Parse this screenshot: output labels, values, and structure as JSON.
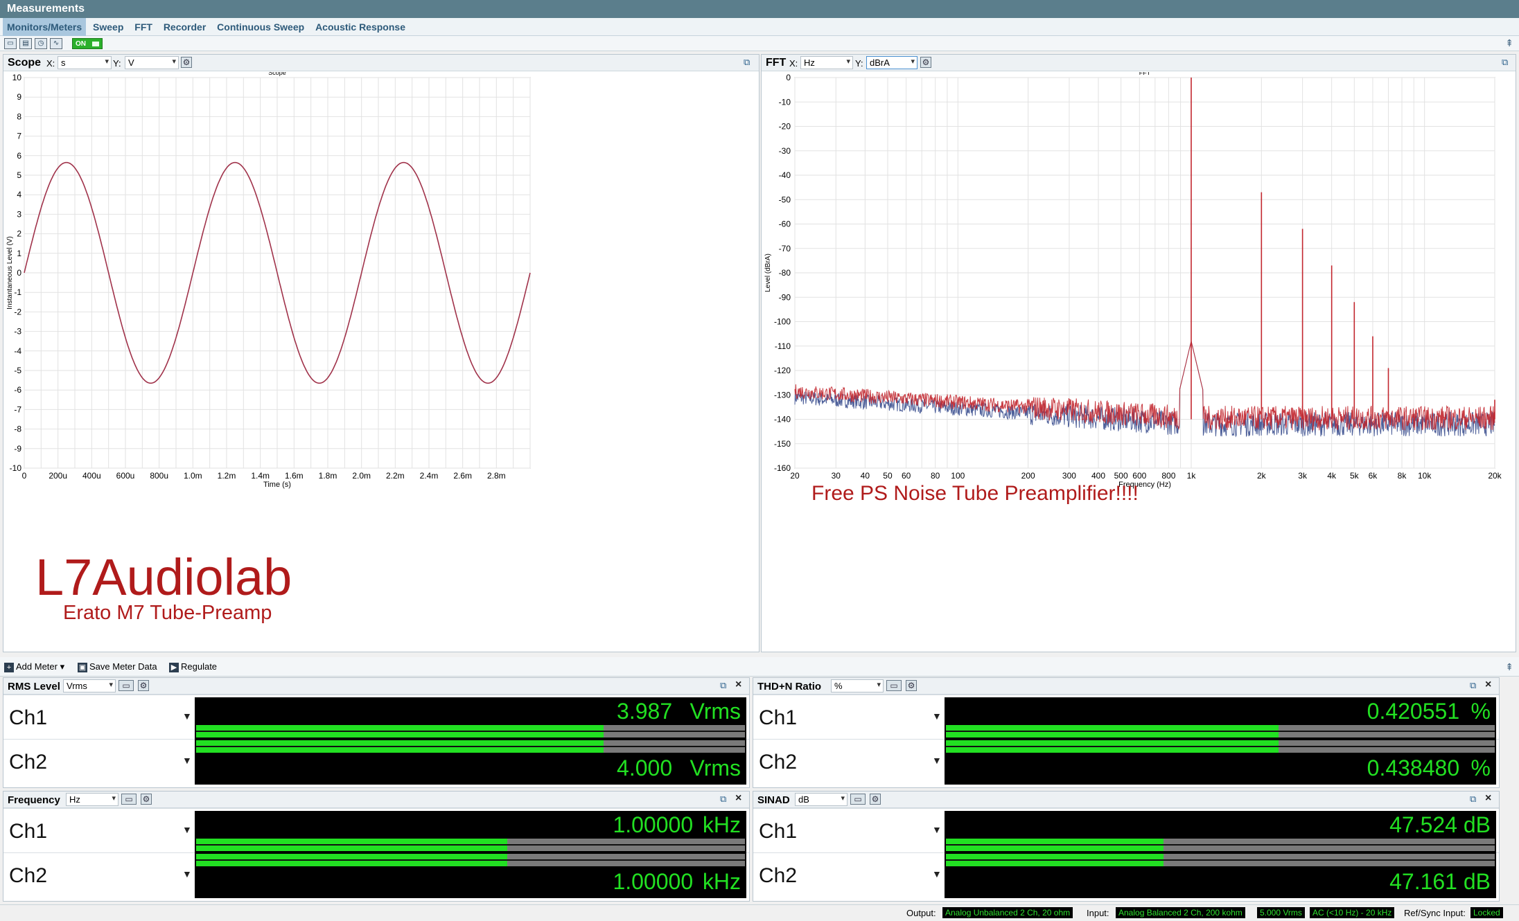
{
  "window": {
    "title": "Measurements"
  },
  "tabs": [
    "Monitors/Meters",
    "Sweep",
    "FFT",
    "Recorder",
    "Continuous Sweep",
    "Acoustic Response"
  ],
  "toolbar": {
    "on_label": "ON"
  },
  "scope": {
    "title": "Scope",
    "x_label": "X:",
    "x_unit": "s",
    "y_label": "Y:",
    "y_unit": "V"
  },
  "fft": {
    "title": "FFT",
    "x_label": "X:",
    "x_unit": "Hz",
    "y_label": "Y:",
    "y_unit": "dBrA"
  },
  "watermark": {
    "brand": "L7Audiolab",
    "subtitle": "Erato M7 Tube-Preamp",
    "fft_note": "Free PS Noise Tube Preamplifier!!!!"
  },
  "chart_data": [
    {
      "type": "line",
      "title": "Scope",
      "xlabel": "Time (s)",
      "ylabel": "Instantaneous Level (V)",
      "xlim": [
        0,
        0.003
      ],
      "ylim": [
        -10,
        10
      ],
      "grid": true,
      "x_ticks": [
        "0",
        "200u",
        "400u",
        "600u",
        "800u",
        "1.0m",
        "1.2m",
        "1.4m",
        "1.6m",
        "1.8m",
        "2.0m",
        "2.2m",
        "2.4m",
        "2.6m",
        "2.8m"
      ],
      "y_ticks": [
        "10",
        "9",
        "8",
        "7",
        "6",
        "5",
        "4",
        "3",
        "2",
        "1",
        "0",
        "-1",
        "-2",
        "-3",
        "-4",
        "-5",
        "-6",
        "-7",
        "-8",
        "-9",
        "-10"
      ],
      "series": [
        {
          "color": "#a0324a",
          "waveform": "sine",
          "frequency_hz": 1000,
          "amplitude_v": 5.65,
          "phase_deg": 0
        }
      ]
    },
    {
      "type": "line",
      "title": "FFT",
      "xlabel": "Frequency (Hz)",
      "ylabel": "Level (dBrA)",
      "xscale": "log",
      "xlim": [
        20,
        20000
      ],
      "ylim": [
        -160,
        0
      ],
      "grid": true,
      "x_ticks": [
        "20",
        "30",
        "40",
        "50",
        "60",
        "80",
        "100",
        "200",
        "300",
        "400",
        "500",
        "600",
        "800",
        "1k",
        "2k",
        "3k",
        "4k",
        "5k",
        "6k",
        "8k",
        "10k",
        "20k"
      ],
      "y_ticks": [
        "0",
        "-10",
        "-20",
        "-30",
        "-40",
        "-50",
        "-60",
        "-70",
        "-80",
        "-90",
        "-100",
        "-110",
        "-120",
        "-130",
        "-140",
        "-150",
        "-160"
      ],
      "noise_floor_db": -141,
      "series": [
        {
          "name": "Ch1",
          "color": "#3b4f8f"
        },
        {
          "name": "Ch2",
          "color": "#c2262e"
        }
      ],
      "peaks": [
        {
          "freq_hz": 1000,
          "level_db": 0
        },
        {
          "freq_hz": 2000,
          "level_db": -47
        },
        {
          "freq_hz": 3000,
          "level_db": -62
        },
        {
          "freq_hz": 4000,
          "level_db": -77
        },
        {
          "freq_hz": 5000,
          "level_db": -92
        },
        {
          "freq_hz": 6000,
          "level_db": -106
        },
        {
          "freq_hz": 7000,
          "level_db": -119
        },
        {
          "freq_hz": 20000,
          "level_db": -132
        }
      ]
    }
  ],
  "meter_toolbar": {
    "add_meter": "Add Meter",
    "save_meter_data": "Save Meter Data",
    "regulate": "Regulate"
  },
  "meters": {
    "rms": {
      "title": "RMS Level",
      "unit_sel": "Vrms",
      "ch1_label": "Ch1",
      "ch1_value": "3.987",
      "ch1_unit": "Vrms",
      "ch1_fill": 0.743,
      "ch2_label": "Ch2",
      "ch2_value": "4.000",
      "ch2_unit": "Vrms",
      "ch2_fill": 0.743
    },
    "thdn": {
      "title": "THD+N Ratio",
      "unit_sel": "%",
      "ch1_label": "Ch1",
      "ch1_value": "0.420551",
      "ch1_unit": "%",
      "ch1_fill": 0.606,
      "ch2_label": "Ch2",
      "ch2_value": "0.438480",
      "ch2_unit": "%",
      "ch2_fill": 0.606
    },
    "freq": {
      "title": "Frequency",
      "unit_sel": "Hz",
      "ch1_label": "Ch1",
      "ch1_value": "1.00000",
      "ch1_unit": "kHz",
      "ch1_fill": 0.567,
      "ch2_label": "Ch2",
      "ch2_value": "1.00000",
      "ch2_unit": "kHz",
      "ch2_fill": 0.567
    },
    "sinad": {
      "title": "SINAD",
      "unit_sel": "dB",
      "ch1_label": "Ch1",
      "ch1_value": "47.524",
      "ch1_unit": "dB",
      "ch1_fill": 0.397,
      "ch2_label": "Ch2",
      "ch2_value": "47.161",
      "ch2_unit": "dB",
      "ch2_fill": 0.397
    }
  },
  "status": {
    "output_label": "Output:",
    "output_value": "Analog Unbalanced 2 Ch, 20 ohm",
    "input_label": "Input:",
    "input_value": "Analog Balanced 2 Ch, 200 kohm",
    "level_value": "5.000 Vrms",
    "filter_value": "AC (<10 Hz) - 20 kHz",
    "ref_label": "Ref/Sync Input:",
    "ref_value": "Locked"
  }
}
